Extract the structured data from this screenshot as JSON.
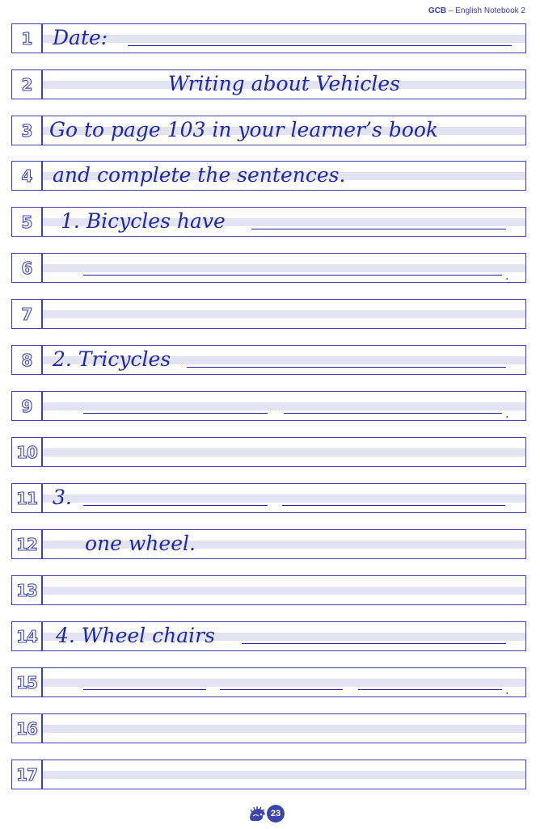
{
  "header": {
    "brand": "GCB",
    "separator": " – ",
    "title": "English Notebook 2"
  },
  "lines": [
    {
      "number": "1",
      "text": "Date:"
    },
    {
      "number": "2",
      "text": "Writing about Vehicles"
    },
    {
      "number": "3",
      "text": "Go to page 103 in your learner’s book"
    },
    {
      "number": "4",
      "text": "and complete the sentences."
    },
    {
      "number": "5",
      "text": "1. Bicycles have"
    },
    {
      "number": "6",
      "text": ""
    },
    {
      "number": "7",
      "text": ""
    },
    {
      "number": "8",
      "text": "2. Tricycles"
    },
    {
      "number": "9",
      "text": ""
    },
    {
      "number": "10",
      "text": ""
    },
    {
      "number": "11",
      "text": "3."
    },
    {
      "number": "12",
      "text": "one wheel."
    },
    {
      "number": "13",
      "text": ""
    },
    {
      "number": "14",
      "text": "4. Wheel chairs"
    },
    {
      "number": "15",
      "text": ""
    },
    {
      "number": "16",
      "text": ""
    },
    {
      "number": "17",
      "text": ""
    }
  ],
  "punctuation": {
    "full_stop": "."
  },
  "footer": {
    "page_number": "23",
    "logo_icon": "hedgehog-logo-icon"
  },
  "colors": {
    "ink": "#1e2a9c",
    "border": "#3d46a8",
    "band": "#e4e3f3"
  }
}
